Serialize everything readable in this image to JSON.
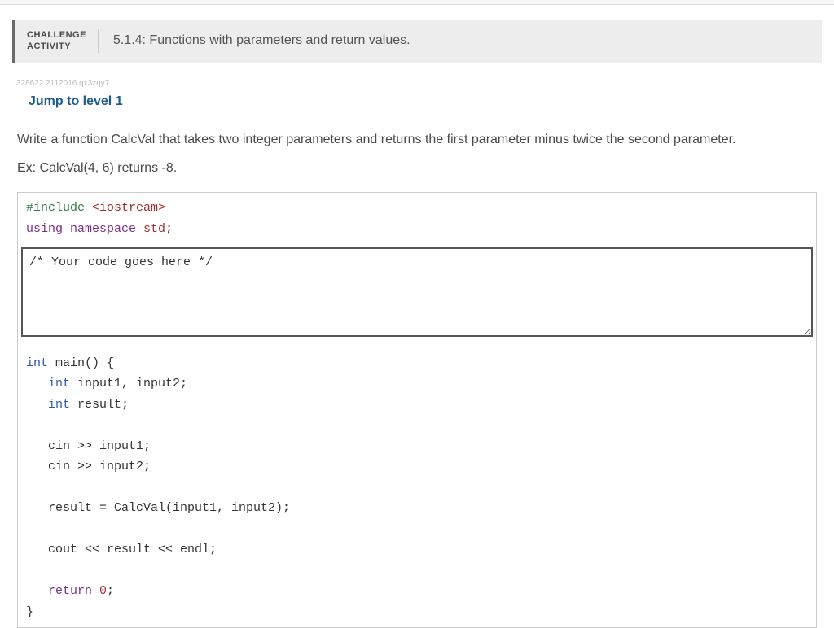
{
  "header": {
    "label_line1": "CHALLENGE",
    "label_line2": "ACTIVITY",
    "title": "5.1.4: Functions with parameters and return values."
  },
  "serial": "328622.2112016.qx3zqy7",
  "jump_link": "Jump to level 1",
  "prompt": "Write a function CalcVal that takes two integer parameters and returns the first parameter minus twice the second parameter.",
  "example": "Ex: CalcVal(4, 6) returns -8.",
  "code": {
    "top_part1": "#include",
    "top_part2": " <iostream>",
    "top_part3": "using",
    "top_part4": " namespace",
    "top_part5": " std",
    "top_part6": ";",
    "placeholder": "/* Your code goes here */",
    "m1": "int",
    "m2": " main",
    "m3": "() {",
    "m4": "   int",
    "m5": " input1, input2;",
    "m6": "   int",
    "m7": " result;",
    "m8": "   cin >> input1;",
    "m9": "   cin >> input2;",
    "m10": "   result = CalcVal(input1, input2);",
    "m11": "   cout << result << endl;",
    "m12": "   return",
    "m13": " 0",
    "m14": ";",
    "m15": "}"
  }
}
